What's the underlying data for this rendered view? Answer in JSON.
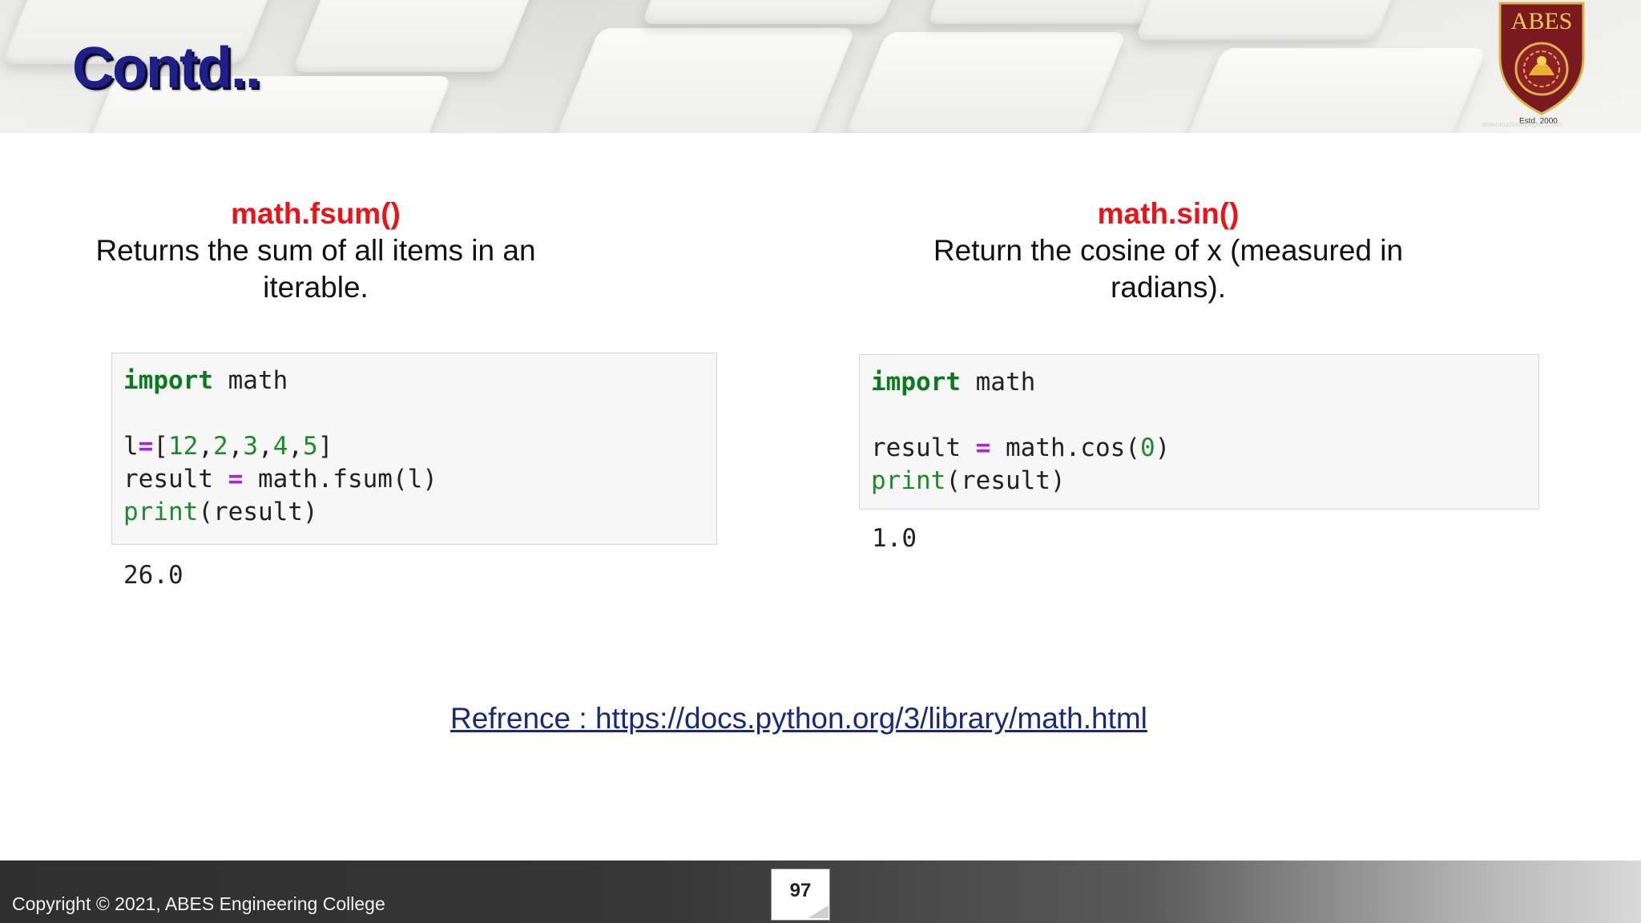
{
  "header": {
    "title": "Contd..",
    "logo_text": "ABES",
    "logo_estd": "Estd. 2000",
    "watermark": "downloadwallpapers.com"
  },
  "left": {
    "function_name": "math.fsum()",
    "description": "Returns the sum of all items in an iterable.",
    "code": {
      "line1_kw": "import",
      "line1_rest": " math",
      "line2_a": "l",
      "line2_op": "=",
      "line2_list": [
        "[",
        "12",
        ",",
        "2",
        ",",
        "3",
        ",",
        "4",
        ",",
        "5",
        "]"
      ],
      "line3_a": "result ",
      "line3_op": "=",
      "line3_b": " math.fsum(l)",
      "line4_fn": "print",
      "line4_rest": "(result)"
    },
    "output": "26.0"
  },
  "right": {
    "function_name": "math.sin()",
    "description": "Return the cosine of x (measured in radians).",
    "code": {
      "line1_kw": "import",
      "line1_rest": " math",
      "line2_a": "result ",
      "line2_op": "=",
      "line2_b": " math.cos(",
      "line2_num": "0",
      "line2_c": ")",
      "line3_fn": "print",
      "line3_rest": "(result)"
    },
    "output": "1.0"
  },
  "reference": "Refrence : https://docs.python.org/3/library/math.html",
  "footer": {
    "copyright": "Copyright © 2021, ABES Engineering College",
    "page_number": "97"
  },
  "colors": {
    "title": "#1f1f8a",
    "function_heading": "#e8141a",
    "keyword": "#0b7a1f",
    "operator": "#a626d9",
    "link": "#1b2a78"
  }
}
